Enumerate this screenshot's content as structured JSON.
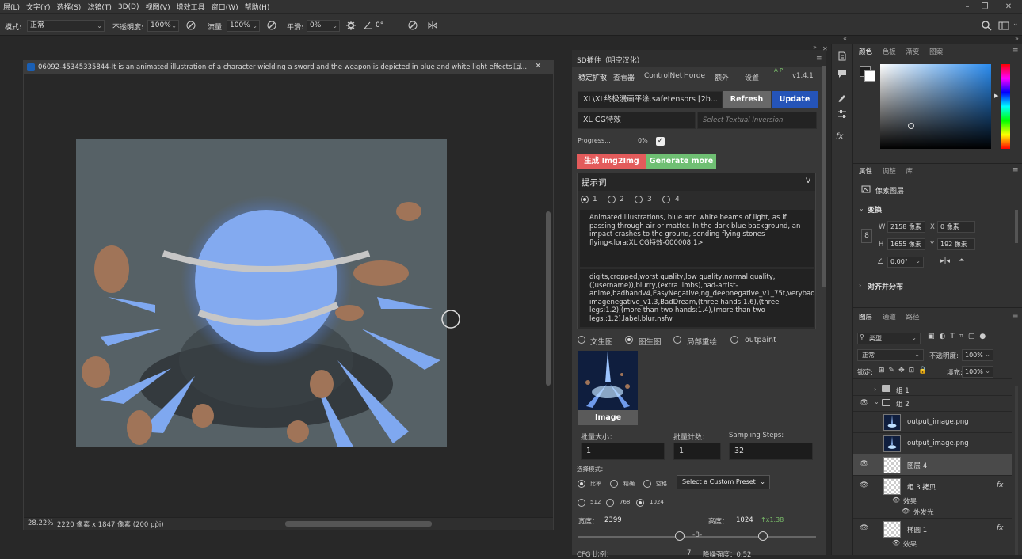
{
  "menu": [
    "层(L)",
    "文字(Y)",
    "选择(S)",
    "滤镜(T)",
    "3D(D)",
    "视图(V)",
    "增效工具",
    "窗口(W)",
    "帮助(H)"
  ],
  "options": {
    "mode_label": "模式:",
    "mode_value": "正常",
    "opacity_label": "不透明度:",
    "opacity_value": "100%",
    "flow_label": "流量:",
    "flow_value": "100%",
    "smooth_label": "平滑:",
    "smooth_value": "0%",
    "angle_value": "0°"
  },
  "document": {
    "title": "06092-45345335844-It is an animated illustration of a character wielding a sword and the weapon is depicted in blue and white light effects, a...",
    "zoom": "28.22%",
    "info": "2220 像素 x 1847 像素 (200 ppi)",
    "info_arrow": "›"
  },
  "sd": {
    "title": "SD插件（明空汉化）",
    "tabs": [
      "稳定扩散",
      "查看器",
      "ControlNet",
      "Horde",
      "额外",
      "设置"
    ],
    "version": "v1.4.1",
    "ap": "A P",
    "model": "XL\\XL终极漫画平涂.safetensors [2b...",
    "refresh": "Refresh",
    "update": "Update",
    "lora": "XL CG特效",
    "textual_inversion_placeholder": "Select Textual Inversion",
    "progress_label": "Progress...",
    "progress_value": "0%",
    "generate_img2img": "生成 Img2Img",
    "generate_more": "Generate more",
    "prompt_header": "提示词",
    "prompt_toggle": "V",
    "prompt_slots": [
      "1",
      "2",
      "3",
      "4"
    ],
    "positive_prompt": "Animated illustrations, blue and white beams of light, as if passing through air or matter. In the dark blue background, an impact crashes to the ground, sending flying stones flying<lora:XL CG特效-000008:1>",
    "negative_prompt": "digits,cropped,worst quality,low quality,normal quality,((username)),blurry,(extra limbs),bad-artist-anime,badhandv4,EasyNegative,ng_deepnegative_v1_75t,verybad imagenegative_v1.3,BadDream,(three hands:1.6),(three legs:1.2),(more than two hands:1.4),(more than two legs,:1.2),label,blur,nsfw",
    "modes": [
      "文生图",
      "图生图",
      "局部重绘",
      "outpaint"
    ],
    "image_label": "Image",
    "batch_size_label": "批量大小：",
    "batch_size": "1",
    "batch_count_label": "批量计数：",
    "batch_count": "1",
    "steps_label": "Sampling Steps:",
    "steps": "32",
    "select_mode_label": "选择模式：",
    "select_modes": [
      "比率",
      "精确",
      "空格"
    ],
    "preset": "Select a Custom Preset",
    "sizes": [
      "512",
      "768",
      "1024"
    ],
    "width_label": "宽度：",
    "width": "2399",
    "height_label": "高度：",
    "height": "1024",
    "scale": "↑x1.38",
    "cfg_label": "CFG 比例：",
    "cfg_value": "7",
    "denoise_label": "降噪强度：0.52"
  },
  "color_panel": {
    "tabs": [
      "颜色",
      "色板",
      "渐变",
      "图案"
    ]
  },
  "properties": {
    "tabs": [
      "属性",
      "调整",
      "库"
    ],
    "kind": "像素图层",
    "transform": "变换",
    "w_label": "W",
    "w": "2158 像素",
    "x_label": "X",
    "x": "0 像素",
    "h_label": "H",
    "h": "1655 像素",
    "y_label": "Y",
    "y": "192 像素",
    "angle": "0.00°",
    "align": "对齐并分布"
  },
  "layers": {
    "tabs": [
      "图层",
      "通道",
      "路径"
    ],
    "filter": "类型",
    "blend": "正常",
    "opacity_label": "不透明度:",
    "opacity": "100%",
    "lock_label": "锁定:",
    "fill_label": "填充:",
    "fill": "100%",
    "items": [
      {
        "name": "组 1"
      },
      {
        "name": "组 2"
      },
      {
        "name": "output_image.png"
      },
      {
        "name": "output_image.png"
      },
      {
        "name": "图层 4"
      },
      {
        "name": "组 3 拷贝"
      },
      {
        "name": "效果"
      },
      {
        "name": "外发光"
      },
      {
        "name": "椭圆 1"
      },
      {
        "name": "效果"
      }
    ],
    "fx": "fx"
  }
}
